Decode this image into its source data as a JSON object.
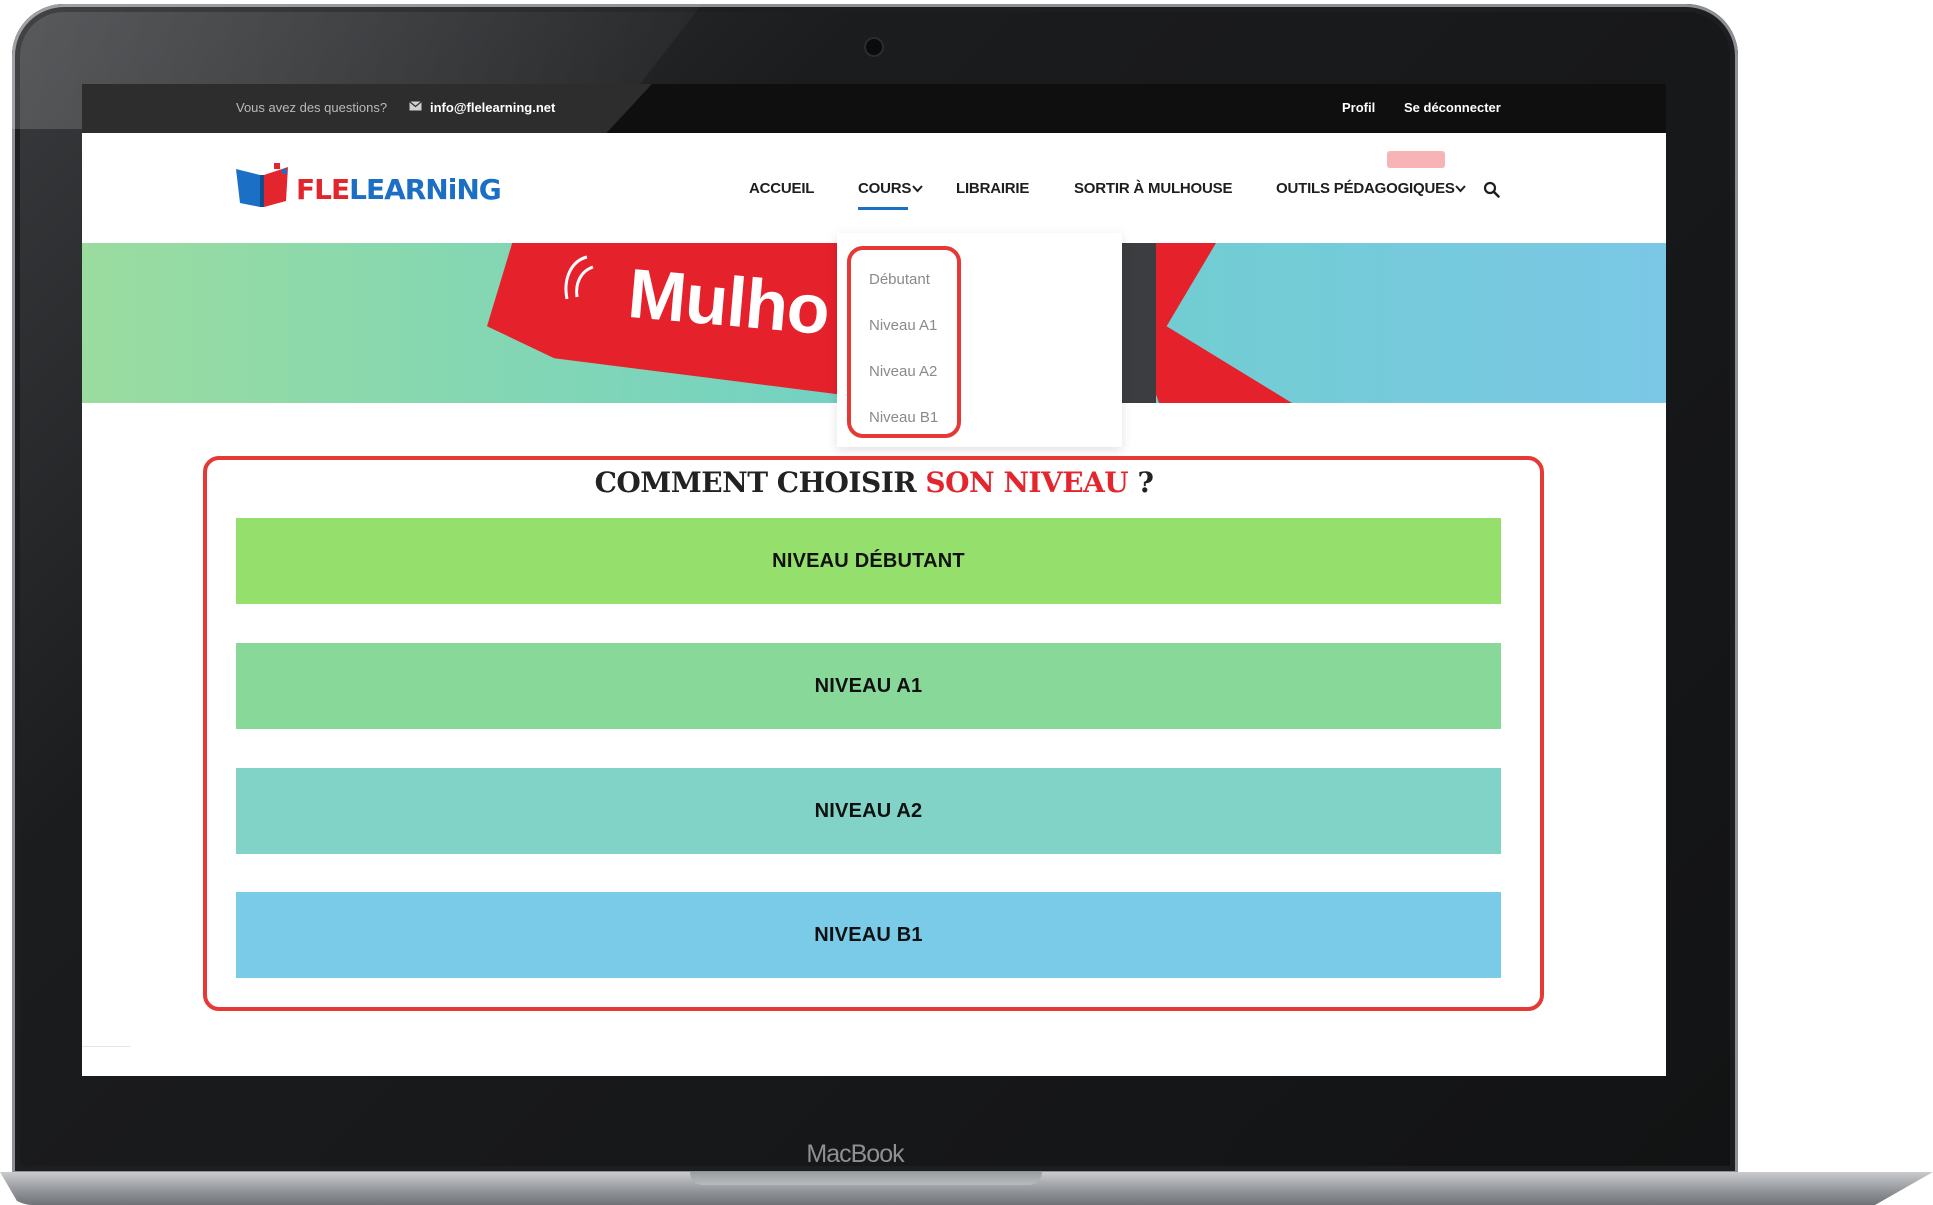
{
  "device": {
    "brand": "MacBook"
  },
  "topbar": {
    "question": "Vous avez des questions?",
    "email": "info@flelearning.net",
    "profil": "Profil",
    "logout": "Se déconnecter",
    "mail_icon": "envelope-icon"
  },
  "header": {
    "logo_part1": "FLE",
    "logo_part2": "LEARNiNG",
    "nav": {
      "accueil": "ACCUEIL",
      "cours": "COURS",
      "librairie": "LIBRAIRIE",
      "sortir": "SORTIR À MULHOUSE",
      "outils": "OUTILS PÉDAGOGIQUES"
    },
    "search_icon": "search-icon"
  },
  "banner": {
    "text": "Mulho"
  },
  "dropdown": {
    "items": [
      "Débutant",
      "Niveau A1",
      "Niveau A2",
      "Niveau B1"
    ]
  },
  "section": {
    "title_main": "COMMENT CHOISIR ",
    "title_accent": "SON NIVEAU",
    "title_end": " ?",
    "levels": [
      "NIVEAU DÉBUTANT",
      "NIVEAU A1",
      "NIVEAU A2",
      "NIVEAU B1"
    ]
  },
  "colors": {
    "accent_red": "#e3262e",
    "brand_blue": "#1b6fc4",
    "level_debutant": "#95e06c",
    "level_a1": "#88d89a",
    "level_a2": "#80d3c6",
    "level_b1": "#79cbe8"
  }
}
